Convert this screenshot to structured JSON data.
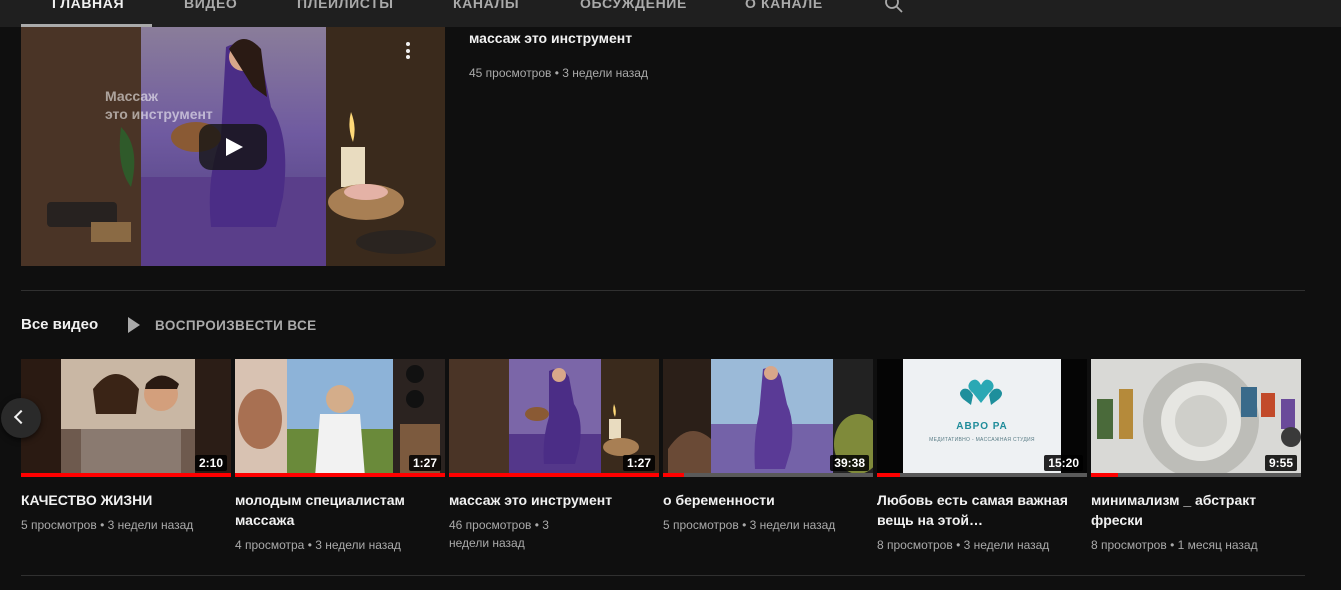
{
  "tabs": [
    {
      "label": "Главная",
      "active": true
    },
    {
      "label": "Видео",
      "active": false
    },
    {
      "label": "Плейлисты",
      "active": false
    },
    {
      "label": "Каналы",
      "active": false
    },
    {
      "label": "Обсуждение",
      "active": false
    },
    {
      "label": "О канале",
      "active": false
    }
  ],
  "featured": {
    "title": "массаж это инструмент",
    "meta": "45 просмотров • 3 недели назад",
    "overlay_text_line1": "Массаж",
    "overlay_text_line2": "это инструмент"
  },
  "section": {
    "title": "Все видео",
    "play_all": "Воспроизвести все"
  },
  "videos": [
    {
      "title": "КАЧЕСТВО ЖИЗНИ",
      "meta": "5 просмотров • 3 недели назад",
      "duration": "2:10",
      "progress": 1.0
    },
    {
      "title": "молодым специалистам массажа",
      "meta": "4 просмотра • 3 недели назад",
      "duration": "1:27",
      "progress": 1.0
    },
    {
      "title": "массаж это инструмент",
      "meta": "46 просмотров • 3 недели назад",
      "duration": "1:27",
      "progress": 1.0
    },
    {
      "title": "о беременности",
      "meta": "5 просмотров • 3 недели назад",
      "duration": "39:38",
      "progress": 0.1
    },
    {
      "title": "Любовь есть самая важная вещь на этой…",
      "meta": "8 просмотров • 3 недели назад",
      "duration": "15:20",
      "progress": 0.11,
      "logo_text": "АВРО  РА",
      "logo_sub": "МЕДИТАТИВНО - МАССАЖНАЯ СТУДИЯ"
    },
    {
      "title": "минимализм _ абстракт фрески",
      "meta": "8 просмотров • 1 месяц назад",
      "duration": "9:55",
      "progress": 0.13
    }
  ],
  "colors": {
    "accent": "#ff0000",
    "background": "#0f0f0f",
    "text_secondary": "#aaaaaa"
  }
}
